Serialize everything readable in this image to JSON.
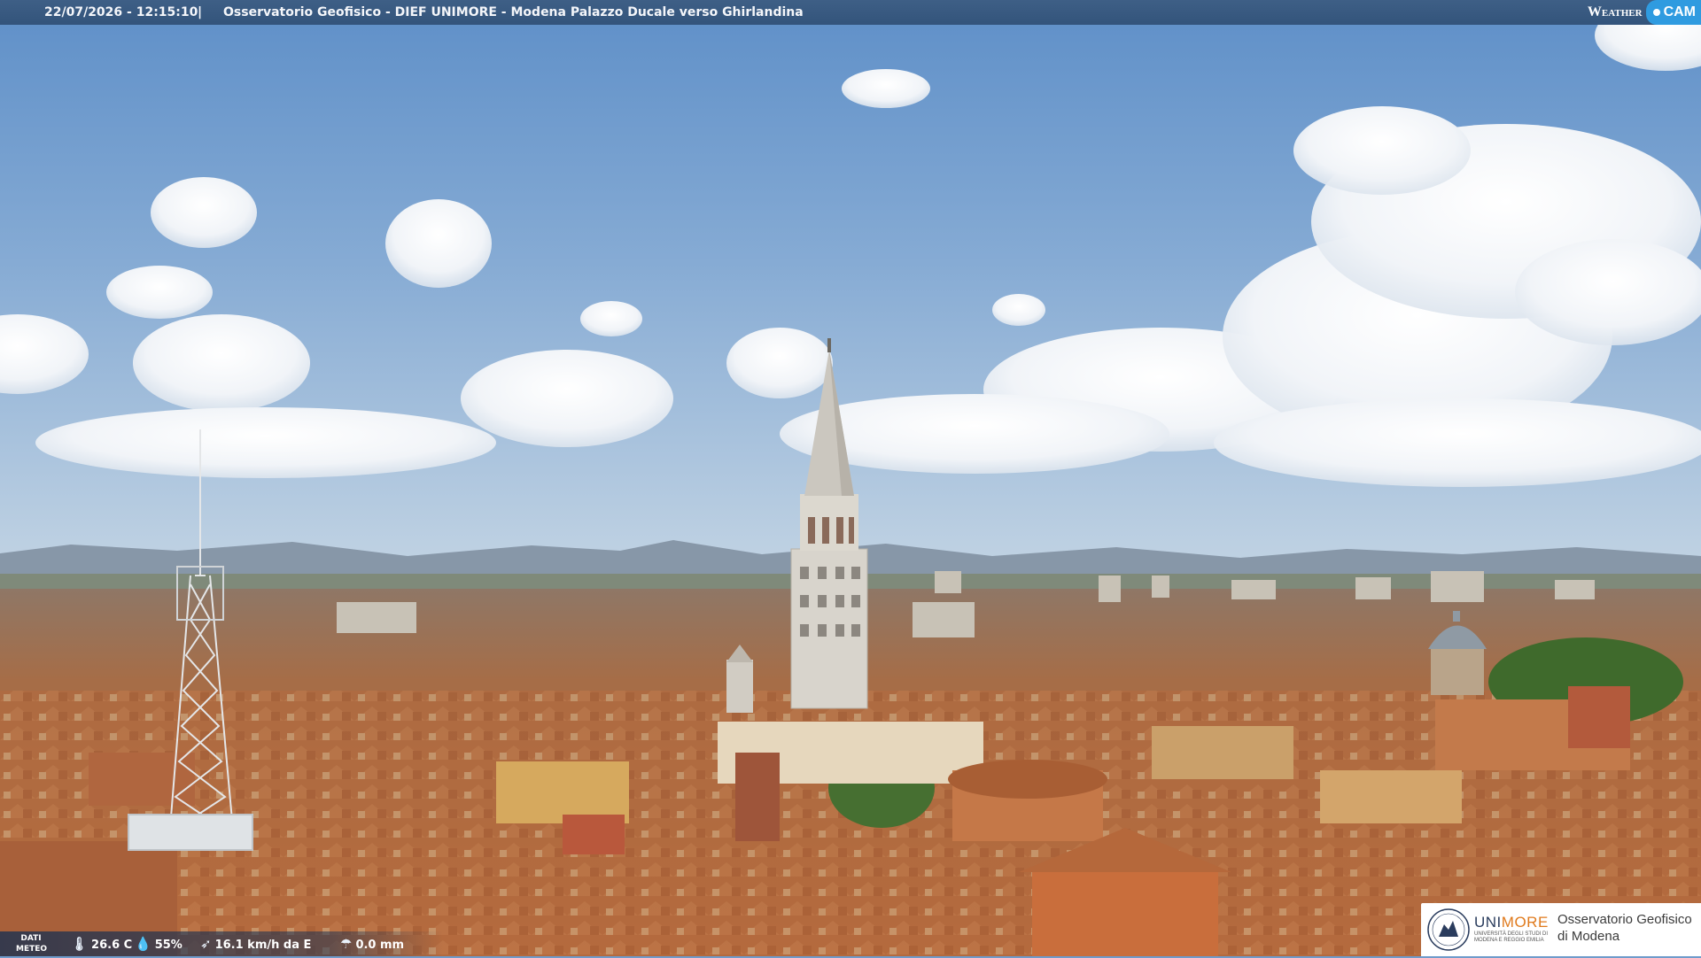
{
  "header": {
    "timestamp": "22/07/2026 - 12:15:10",
    "separator": "|",
    "title": "Osservatorio Geofisico - DIEF UNIMORE - Modena Palazzo Ducale verso Ghirlandina"
  },
  "brand": {
    "weather": "Weather",
    "cam": "CAM"
  },
  "weather_strip": {
    "label": "DATI METEO",
    "temperature": "26.6 C",
    "humidity": "55%",
    "wind": "16.1 km/h da E",
    "rain": "0.0 mm",
    "icons": [
      "thermometer-icon",
      "humidity-drop-icon",
      "wind-icon",
      "rain-icon"
    ]
  },
  "logo": {
    "uni_prefix": "UNI",
    "uni_suffix": "MORE",
    "uni_sub": "UNIVERSITÀ DEGLI STUDI DI MODENA E REGGIO EMILIA",
    "obs_line1": "Osservatorio Geofisico",
    "obs_line2": "di Modena"
  },
  "colors": {
    "sky_top": "#5e8fc8",
    "sky_horizon": "#b9cfe3",
    "roof": "#b5693c",
    "tower": "#d9d6cf",
    "bar": "#3a5b82",
    "brand_cam": "#2f9be0",
    "logo_orange": "#e07a1c"
  }
}
